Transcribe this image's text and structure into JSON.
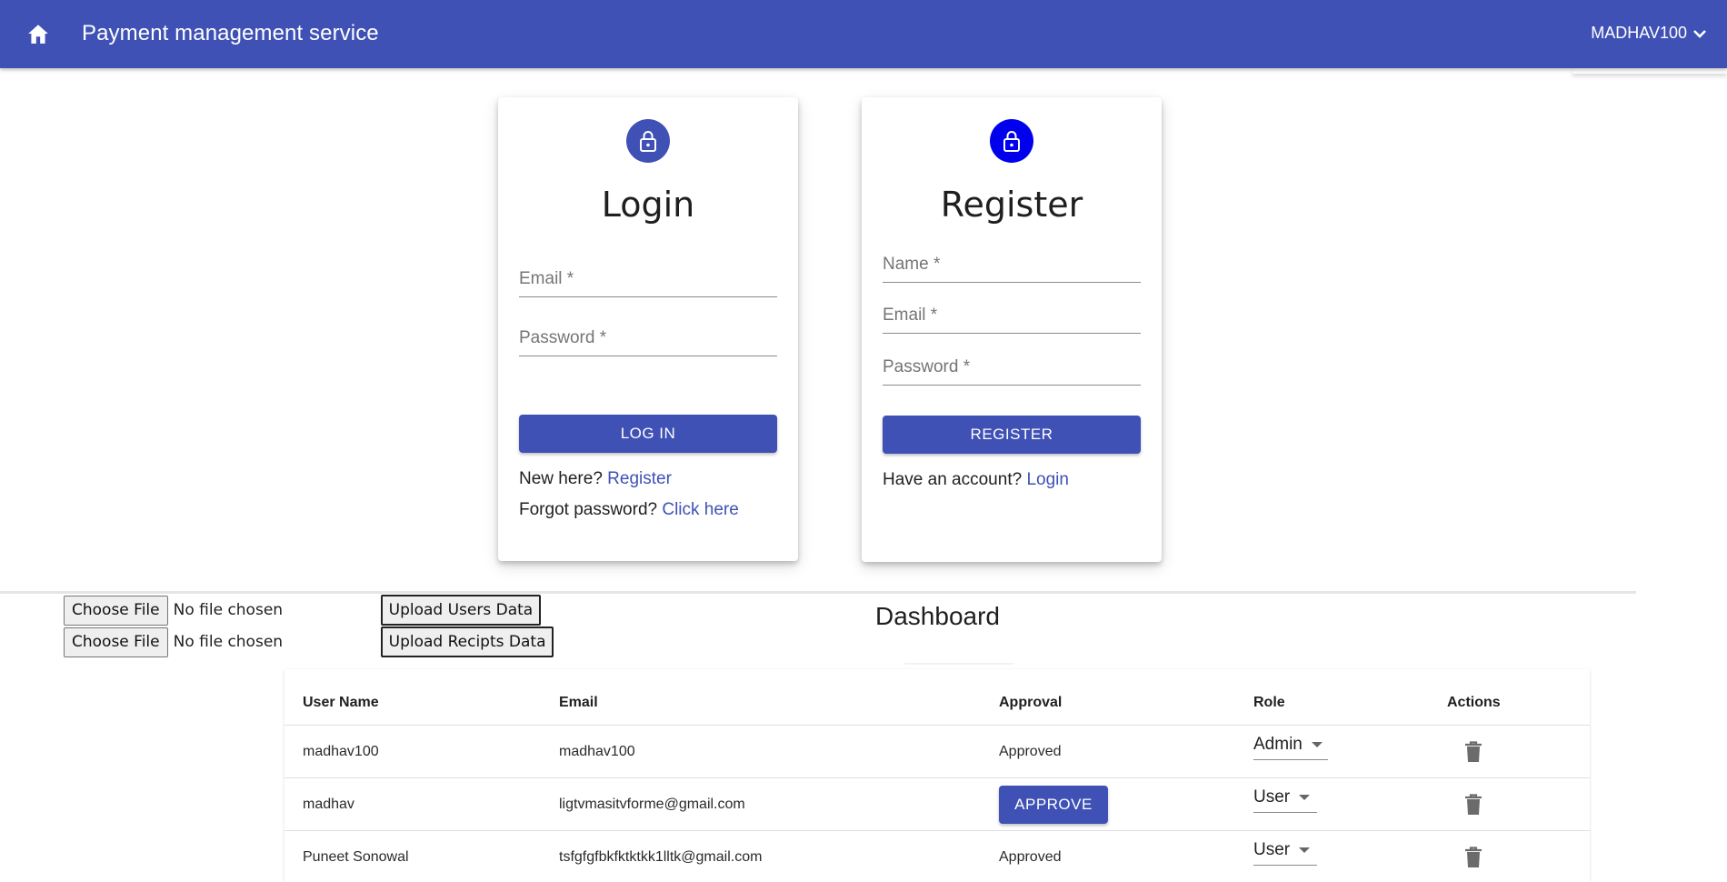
{
  "appbar": {
    "home_icon": "home-icon",
    "title": "Payment management service",
    "user_label": "MADHAV100",
    "user_caret_icon": "chevron-down-icon"
  },
  "login_card": {
    "icon": "lock-icon",
    "title": "Login",
    "email_placeholder": "Email *",
    "email_value": "",
    "password_placeholder": "Password *",
    "password_value": "",
    "submit_label": "LOG IN",
    "new_here_text": "New here? ",
    "register_link": "Register",
    "forgot_text": "Forgot password? ",
    "forgot_link": "Click here",
    "accent_color": "#3f51b5"
  },
  "register_card": {
    "icon": "lock-icon",
    "title": "Register",
    "name_placeholder": "Name *",
    "email_placeholder": "Email *",
    "password_placeholder": "Password *",
    "submit_label": "REGISTER",
    "have_account_text": "Have an account? ",
    "login_link": "Login",
    "accent_color": "#0000ee"
  },
  "uploads": [
    {
      "choose_label": "Choose File",
      "status": "No file chosen",
      "upload_label": "Upload Users Data"
    },
    {
      "choose_label": "Choose File",
      "status": "No file chosen",
      "upload_label": "Upload Recipts Data"
    }
  ],
  "dashboard": {
    "title": "Dashboard",
    "columns": [
      "User Name",
      "Email",
      "Approval",
      "Role",
      "Actions"
    ],
    "rows": [
      {
        "user_name": "madhav100",
        "email": "madhav100",
        "approval": "Approved",
        "approve_button": "",
        "role": "Admin",
        "action_icon": "trash-icon"
      },
      {
        "user_name": "madhav",
        "email": "ligtvmasitvforme@gmail.com",
        "approval": "",
        "approve_button": "APPROVE",
        "role": "User",
        "action_icon": "trash-icon"
      },
      {
        "user_name": "Puneet Sonowal",
        "email": "tsfgfgfbkfktktkk1lltk@gmail.com",
        "approval": "Approved",
        "approve_button": "",
        "role": "User",
        "action_icon": "trash-icon"
      }
    ]
  }
}
